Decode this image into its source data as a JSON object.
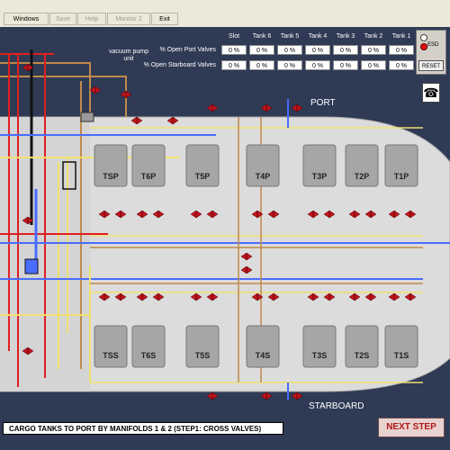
{
  "menu": {
    "windows": "Windows",
    "save": "Save",
    "help": "Help",
    "monitor2": "Monitor 2",
    "exit": "Exit"
  },
  "valve_table": {
    "columns": [
      "Slot",
      "Tank 6",
      "Tank 5",
      "Tank 4",
      "Tank 3",
      "Tank 2",
      "Tank 1"
    ],
    "rows": [
      {
        "label": "% Open Port Valves",
        "values": [
          "0 %",
          "0 %",
          "0 %",
          "0 %",
          "0 %",
          "0 %",
          "0 %"
        ]
      },
      {
        "label": "% Open Starboard Valves",
        "values": [
          "0 %",
          "0 %",
          "0 %",
          "0 %",
          "0 %",
          "0 %",
          "0 %"
        ]
      }
    ]
  },
  "esd": {
    "label": "ESD",
    "reset": "RESET"
  },
  "phone_icon": "☎",
  "vacuum_label": "vacuum pump unit",
  "port_label": "PORT",
  "starboard_label": "STARBOARD",
  "tanks": {
    "port": [
      "TSP",
      "T6P",
      "T5P",
      "T4P",
      "T3P",
      "T2P",
      "T1P"
    ],
    "starboard": [
      "TSS",
      "T6S",
      "T5S",
      "T4S",
      "T3S",
      "T2S",
      "T1S"
    ]
  },
  "footer": {
    "title": "CARGO TANKS TO PORT BY MANIFOLDS 1 & 2 (STEP1: CROSS VALVES)",
    "next_step": "NEXT STEP"
  },
  "colors": {
    "background": "#2f3a55",
    "hull": "#dcdcdc",
    "tank": "#a6a6a6",
    "valve": "#c0141e",
    "pipe_yellow": "#f0e070",
    "pipe_blue": "#4a6cff",
    "pipe_red": "#e02020",
    "pipe_brown": "#c08a4a"
  }
}
